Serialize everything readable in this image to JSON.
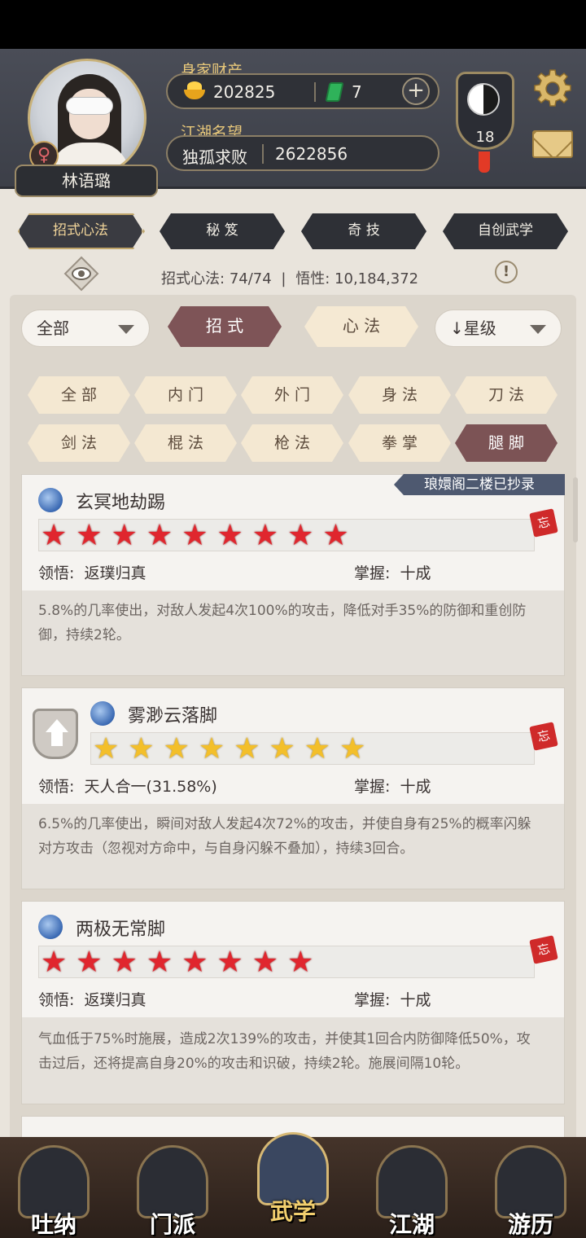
{
  "profile": {
    "name": "林语璐",
    "gender_symbol": "♀",
    "wealth_label": "身家财产",
    "gold_amount": "202825",
    "jade_amount": "7",
    "plus_symbol": "+",
    "reputation_label": "江湖名望",
    "title": "独孤求败",
    "reputation_value": "2622856",
    "level": "18"
  },
  "top_tabs": [
    {
      "label": "招式心法",
      "active": true
    },
    {
      "label": "秘 笈",
      "active": false
    },
    {
      "label": "奇 技",
      "active": false
    },
    {
      "label": "自创武学",
      "active": false
    }
  ],
  "stats": {
    "count_label": "招式心法:",
    "count_value": "74/74",
    "insight_label": "悟性:",
    "insight_value": "10,184,372",
    "separator": "|",
    "warn_symbol": "!"
  },
  "toolbar": {
    "dropdown_all": "全部",
    "seg_moves": "招 式",
    "seg_mind": "心 法",
    "sort_label": "↓星级"
  },
  "filters": [
    {
      "label": "全 部",
      "active": false
    },
    {
      "label": "内 门",
      "active": false
    },
    {
      "label": "外 门",
      "active": false
    },
    {
      "label": "身 法",
      "active": false
    },
    {
      "label": "刀 法",
      "active": false
    },
    {
      "label": "剑 法",
      "active": false
    },
    {
      "label": "棍 法",
      "active": false
    },
    {
      "label": "枪 法",
      "active": false
    },
    {
      "label": "拳 掌",
      "active": false
    },
    {
      "label": "腿 脚",
      "active": true
    }
  ],
  "skills": [
    {
      "name": "玄冥地劫踢",
      "stars": 9,
      "star_color": "red",
      "banner": "琅嬛阁二楼已抄录",
      "insight_label": "领悟:",
      "insight": "返璞归真",
      "mastery_label": "掌握:",
      "mastery": "十成",
      "forget_tag": "忘",
      "description": "5.8%的几率使出，对敌人发起4次100%的攻击，降低对手35%的防御和重创防御，持续2轮。"
    },
    {
      "name": "雾渺云落脚",
      "stars": 8,
      "star_color": "gold",
      "insight_label": "领悟:",
      "insight": "天人合一(31.58%)",
      "mastery_label": "掌握:",
      "mastery": "十成",
      "forget_tag": "忘",
      "description": "6.5%的几率使出，瞬间对敌人发起4次72%的攻击，并使自身有25%的概率闪躲对方攻击（忽视对方命中，与自身闪躲不叠加），持续3回合。"
    },
    {
      "name": "两极无常脚",
      "stars": 8,
      "star_color": "red",
      "insight_label": "领悟:",
      "insight": "返璞归真",
      "mastery_label": "掌握:",
      "mastery": "十成",
      "forget_tag": "忘",
      "description": "气血低于75%时施展，造成2次139%的攻击，并使其1回合内防御降低50%，攻击过后，还将提高自身20%的攻击和识破，持续2轮。施展间隔10轮。"
    }
  ],
  "bottom_nav": [
    {
      "label": "吐纳",
      "icon": "monk-icon",
      "active": false
    },
    {
      "label": "门派",
      "icon": "flags-icon",
      "active": false
    },
    {
      "label": "武学",
      "icon": "book-icon",
      "active": true
    },
    {
      "label": "江湖",
      "icon": "hat-icon",
      "active": false
    },
    {
      "label": "游历",
      "icon": "horse-icon",
      "active": false
    }
  ],
  "colors": {
    "accent": "#7c5355",
    "gold_text": "#e8c87a",
    "star_red": "#e0262e",
    "star_gold": "#f3bf2a"
  }
}
